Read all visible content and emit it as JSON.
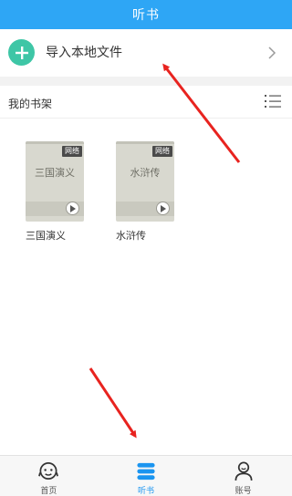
{
  "header": {
    "title": "听书"
  },
  "import": {
    "label": "导入本地文件"
  },
  "shelf": {
    "title": "我的书架",
    "books": [
      {
        "cover_title": "三国演义",
        "badge": "网络",
        "name": "三国演义"
      },
      {
        "cover_title": "水浒传",
        "badge": "网络",
        "name": "水浒传"
      }
    ]
  },
  "tabs": [
    {
      "label": "首页",
      "icon": "face-icon",
      "active": false
    },
    {
      "label": "听书",
      "icon": "books-icon",
      "active": true
    },
    {
      "label": "账号",
      "icon": "user-icon",
      "active": false
    }
  ],
  "colors": {
    "titlebar": "#2ea6f5",
    "plus": "#3ec6a6",
    "active_tab": "#1b95f0",
    "annotation_arrow": "#e8231f"
  }
}
